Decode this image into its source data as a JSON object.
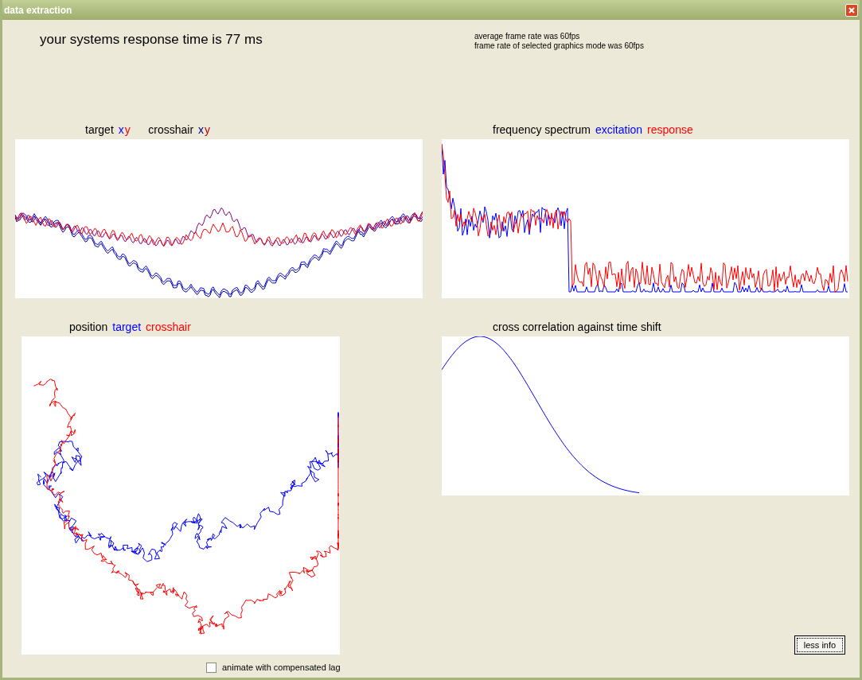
{
  "window": {
    "title": "data extraction"
  },
  "response_time": "your systems response time is 77 ms",
  "frame_rates": [
    "average frame rate was 60fps",
    "frame rate of selected graphics mode was 60fps"
  ],
  "plots": [
    {
      "heading": [
        {
          "text": "target "
        },
        {
          "text": "x",
          "color": "#0000ff"
        },
        {
          "text": "y",
          "color": "#ff0000"
        },
        {
          "text": "crosshair "
        },
        {
          "text": "x",
          "color": "#000080"
        },
        {
          "text": "y",
          "color": "#c00000"
        }
      ],
      "kind": "xy"
    },
    {
      "heading": [
        {
          "text": "frequency spectrum "
        },
        {
          "text": "excitation",
          "color": "#0000ff"
        },
        {
          "text": "response",
          "color": "#ff0000"
        }
      ],
      "kind": "spectrum"
    },
    {
      "heading": [
        {
          "text": "position "
        },
        {
          "text": "target",
          "color": "#0000ff"
        },
        {
          "text": "crosshair",
          "color": "#ff0000"
        }
      ],
      "kind": "position"
    },
    {
      "heading": [
        {
          "text": "cross correlation against time shift"
        }
      ],
      "kind": "correlation"
    }
  ],
  "checkbox": {
    "label": "animate with compensated lag",
    "checked": false
  },
  "button": "less info"
}
